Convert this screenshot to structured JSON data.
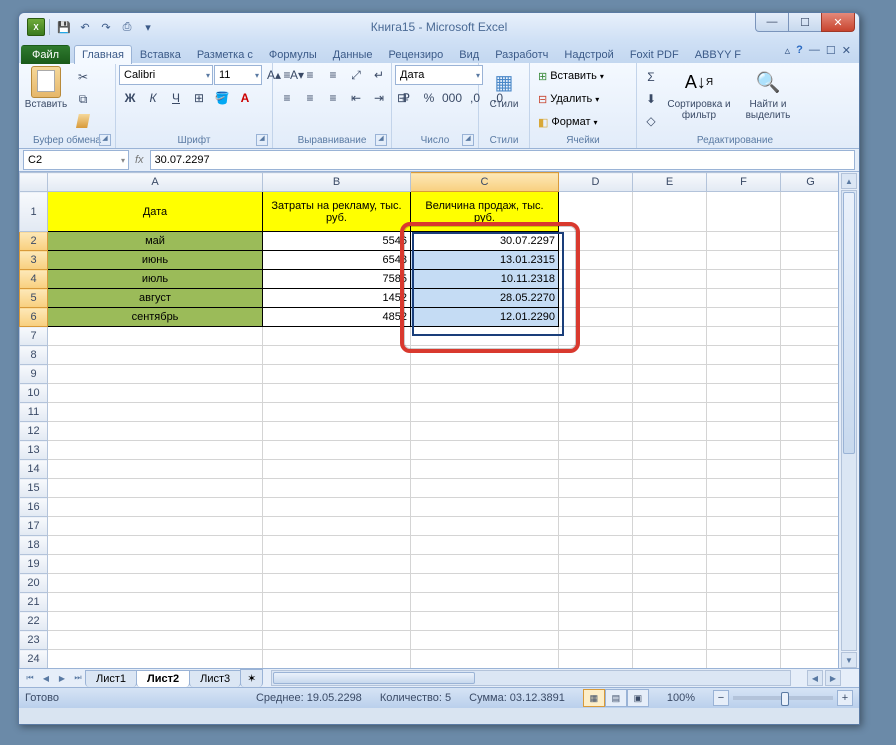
{
  "title": "Книга15 - Microsoft Excel",
  "qat": {
    "save": "💾",
    "undo": "↶",
    "redo": "↷",
    "down": "▾"
  },
  "win": {
    "min": "—",
    "max": "☐",
    "close": "✕"
  },
  "tabs": {
    "file": "Файл",
    "home": "Главная",
    "insert": "Вставка",
    "layout": "Разметка с",
    "formulas": "Формулы",
    "data": "Данные",
    "review": "Рецензиро",
    "view": "Вид",
    "developer": "Разработч",
    "addins": "Надстрой",
    "foxit": "Foxit PDF",
    "abbyy": "ABBYY F"
  },
  "help": {
    "caret": "▵",
    "help": "?",
    "min2": "—",
    "max2": "☐",
    "close2": "✕"
  },
  "ribbon": {
    "clipboard": {
      "paste": "Вставить",
      "label": "Буфер обмена",
      "cut": "✂",
      "copy": "⧉"
    },
    "font": {
      "label": "Шрифт",
      "name": "Calibri",
      "size": "11",
      "bold": "Ж",
      "italic": "К",
      "underline": "Ч",
      "border": "⊞",
      "fill": "🪣",
      "color": "A"
    },
    "align": {
      "label": "Выравнивание"
    },
    "number": {
      "label": "Число",
      "format": "Дата",
      "pct": "%",
      "comma": "000"
    },
    "styles": {
      "label": "Стили",
      "btn": "Стили"
    },
    "cells": {
      "label": "Ячейки",
      "insert": "Вставить",
      "delete": "Удалить",
      "format": "Формат"
    },
    "editing": {
      "label": "Редактирование",
      "sum": "Σ",
      "fill": "⬇",
      "clear": "◇",
      "sort": "Сортировка и фильтр",
      "find": "Найти и выделить"
    }
  },
  "namebox": "C2",
  "formula": "30.07.2297",
  "cols": [
    "A",
    "B",
    "C",
    "D",
    "E",
    "F",
    "G"
  ],
  "rows": [
    1,
    2,
    3,
    4,
    5,
    6,
    7,
    8,
    9,
    10,
    11,
    12,
    13,
    14,
    15,
    16,
    17,
    18,
    19,
    20,
    21,
    22,
    23,
    24
  ],
  "headers": {
    "a": "Дата",
    "b": "Затраты на рекламу, тыс. руб.",
    "c": "Величина продаж, тыс. руб."
  },
  "data": [
    {
      "a": "май",
      "b": "5546",
      "c": "30.07.2297"
    },
    {
      "a": "июнь",
      "b": "6548",
      "c": "13.01.2315"
    },
    {
      "a": "июль",
      "b": "7585",
      "c": "10.11.2318"
    },
    {
      "a": "август",
      "b": "1452",
      "c": "28.05.2270"
    },
    {
      "a": "сентябрь",
      "b": "4852",
      "c": "12.01.2290"
    }
  ],
  "sheets": {
    "s1": "Лист1",
    "s2": "Лист2",
    "s3": "Лист3"
  },
  "status": {
    "ready": "Готово",
    "avg": "Среднее: 19.05.2298",
    "count": "Количество: 5",
    "sum": "Сумма: 03.12.3891",
    "zoom": "100%"
  }
}
